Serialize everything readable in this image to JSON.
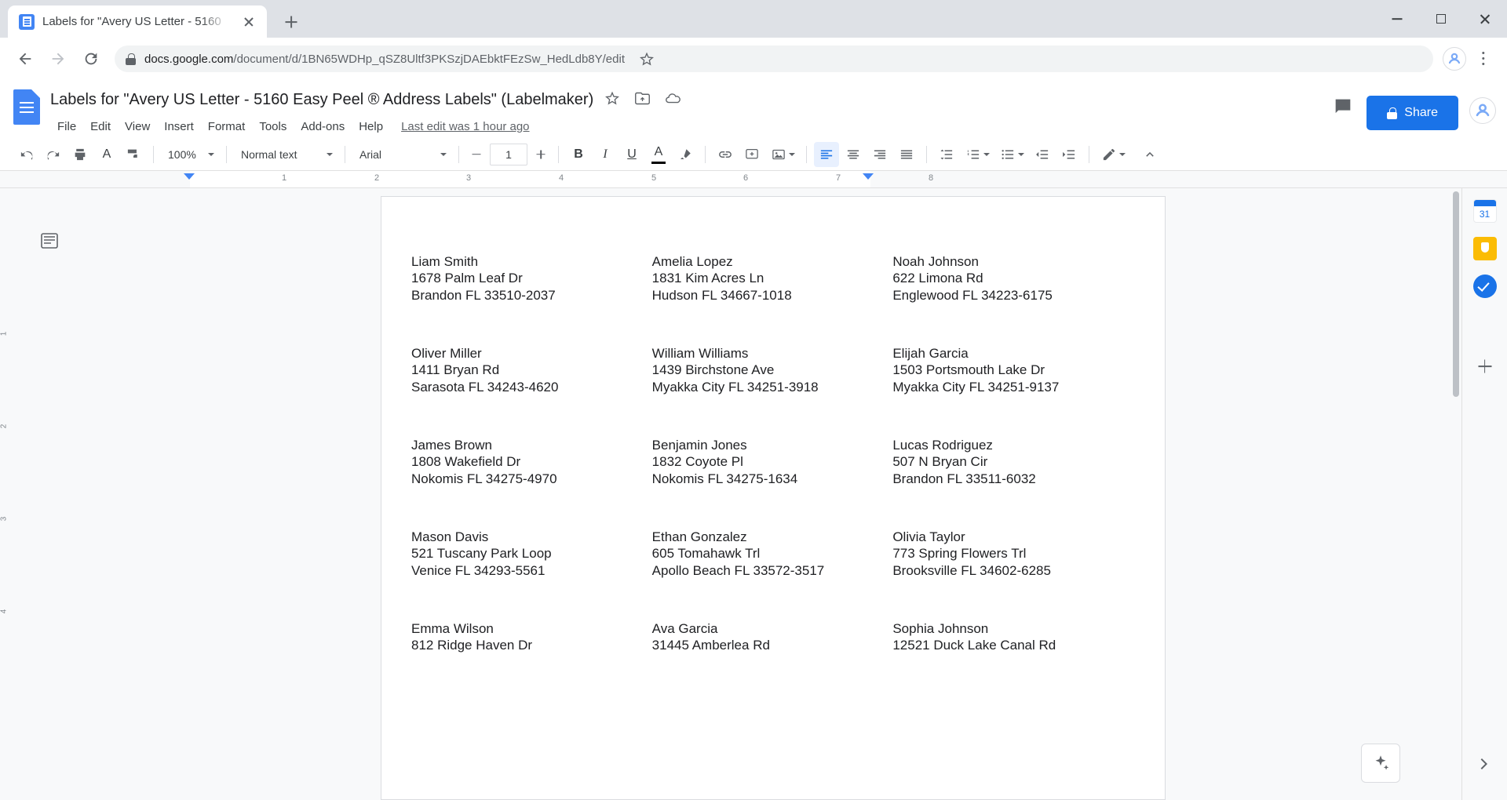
{
  "browser": {
    "tab": {
      "title": "Labels for \"Avery US Letter - 5160",
      "favicon_name": "google-docs-favicon"
    },
    "new_tab_label": "+",
    "url_domain": "docs.google.com",
    "url_path": "/document/d/1BN65WDHp_qSZ8Ultf3PKSzjDAEbktFEzSw_HedLdb8Y/edit",
    "window_controls": {
      "minimize": "minimize",
      "maximize": "maximize",
      "close": "close"
    }
  },
  "docs": {
    "title": "Labels for \"Avery US Letter - 5160 Easy Peel ® Address Labels\" (Labelmaker)",
    "menus": [
      "File",
      "Edit",
      "View",
      "Insert",
      "Format",
      "Tools",
      "Add-ons",
      "Help"
    ],
    "last_edit": "Last edit was 1 hour ago",
    "share_label": "Share",
    "toolbar": {
      "zoom": "100%",
      "style": "Normal text",
      "font": "Arial",
      "font_size": "1"
    },
    "ruler": {
      "ticks": [
        "1",
        "2",
        "3",
        "4",
        "5",
        "6",
        "7",
        "8"
      ],
      "vertical_ticks": [
        "1",
        "2",
        "3",
        "4"
      ]
    }
  },
  "document": {
    "labels": [
      {
        "name": "Liam Smith",
        "street": "1678 Palm Leaf Dr",
        "citystatezip": "Brandon FL 33510-2037"
      },
      {
        "name": "Amelia Lopez",
        "street": "1831 Kim Acres Ln",
        "citystatezip": "Hudson FL 34667-1018"
      },
      {
        "name": "Noah Johnson",
        "street": "622 Limona Rd",
        "citystatezip": "Englewood FL 34223-6175"
      },
      {
        "name": "Oliver Miller",
        "street": "1411 Bryan Rd",
        "citystatezip": "Sarasota FL 34243-4620"
      },
      {
        "name": "William Williams",
        "street": "1439 Birchstone Ave",
        "citystatezip": "Myakka City FL 34251-3918"
      },
      {
        "name": "Elijah Garcia",
        "street": "1503 Portsmouth Lake Dr",
        "citystatezip": "Myakka City FL 34251-9137"
      },
      {
        "name": "James Brown",
        "street": "1808 Wakefield Dr",
        "citystatezip": "Nokomis FL 34275-4970"
      },
      {
        "name": "Benjamin Jones",
        "street": "1832 Coyote Pl",
        "citystatezip": "Nokomis FL 34275-1634"
      },
      {
        "name": "Lucas Rodriguez",
        "street": "507 N Bryan Cir",
        "citystatezip": "Brandon FL 33511-6032"
      },
      {
        "name": "Mason Davis",
        "street": "521 Tuscany Park Loop",
        "citystatezip": "Venice FL 34293-5561"
      },
      {
        "name": "Ethan Gonzalez",
        "street": "605 Tomahawk Trl",
        "citystatezip": "Apollo Beach FL 33572-3517"
      },
      {
        "name": "Olivia Taylor",
        "street": "773 Spring Flowers Trl",
        "citystatezip": "Brooksville FL 34602-6285"
      },
      {
        "name": "Emma Wilson",
        "street": "812 Ridge Haven Dr",
        "citystatezip": ""
      },
      {
        "name": "Ava Garcia",
        "street": "31445 Amberlea Rd",
        "citystatezip": ""
      },
      {
        "name": "Sophia Johnson",
        "street": "12521 Duck Lake Canal Rd",
        "citystatezip": ""
      }
    ]
  },
  "side_panel": {
    "calendar_day": "31",
    "items": [
      "calendar-icon",
      "keep-icon",
      "tasks-icon",
      "add-ons-plus"
    ]
  },
  "colors": {
    "brand_blue": "#1a73e8",
    "tab_strip": "#dee1e6",
    "toolbar_active": "#e8f0fe",
    "text_primary": "#202124",
    "text_secondary": "#5f6368"
  }
}
